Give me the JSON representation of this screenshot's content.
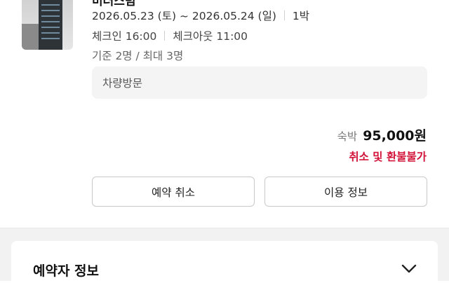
{
  "booking": {
    "title": "미러스텀",
    "dates": "2026.05.23 (토) ~ 2026.05.24 (일)",
    "nights": "1박",
    "checkin": "체크인 16:00",
    "checkout": "체크아웃 11:00",
    "capacity": "기준 2명 / 최대 3명",
    "visit_method": "차량방문",
    "price_label": "숙박",
    "price": "95,000원",
    "refund_policy": "취소 및 환불불가"
  },
  "actions": {
    "cancel_label": "예약 취소",
    "info_label": "이용 정보"
  },
  "reserver_section": {
    "title": "예약자 정보",
    "icon": "chevron-down-icon"
  },
  "colors": {
    "accent_red": "#d2143a",
    "box_bg": "#f4f4f4",
    "band_bg": "#f2f2f2"
  }
}
